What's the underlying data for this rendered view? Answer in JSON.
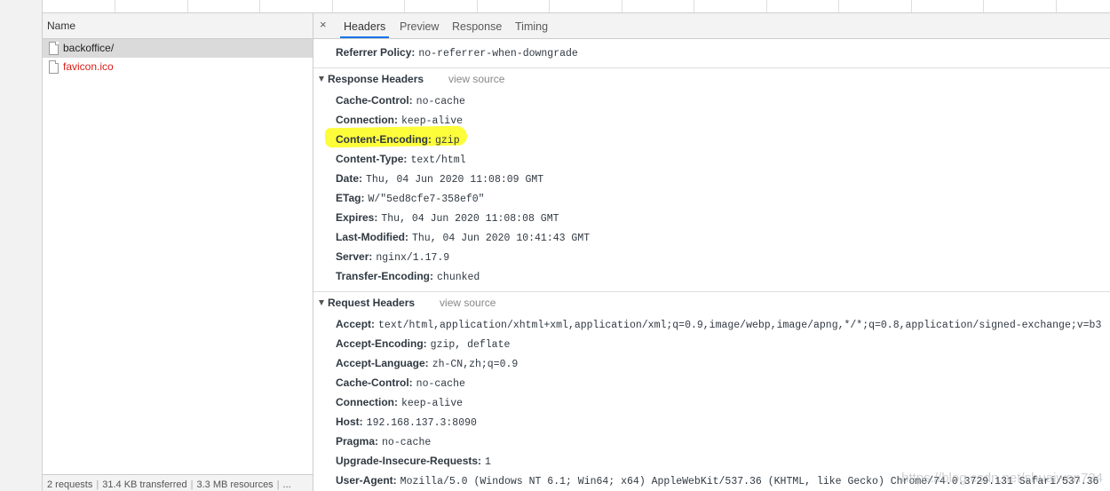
{
  "request_list": {
    "column_header": "Name",
    "rows": [
      {
        "name": "backoffice/",
        "selected": true,
        "error": false
      },
      {
        "name": "favicon.ico",
        "selected": false,
        "error": true
      }
    ],
    "status": {
      "requests": "2 requests",
      "transferred": "31.4 KB transferred",
      "resources": "3.3 MB resources",
      "more": "..."
    }
  },
  "details": {
    "close_symbol": "×",
    "tabs": [
      "Headers",
      "Preview",
      "Response",
      "Timing"
    ],
    "active_tab": "Headers",
    "general": [
      {
        "key": "Referrer Policy:",
        "value": "no-referrer-when-downgrade"
      }
    ],
    "response_headers": {
      "title": "Response Headers",
      "view_source": "view source",
      "items": [
        {
          "key": "Cache-Control:",
          "value": "no-cache"
        },
        {
          "key": "Connection:",
          "value": "keep-alive"
        },
        {
          "key": "Content-Encoding:",
          "value": "gzip"
        },
        {
          "key": "Content-Type:",
          "value": "text/html"
        },
        {
          "key": "Date:",
          "value": "Thu, 04 Jun 2020 11:08:09 GMT"
        },
        {
          "key": "ETag:",
          "value": "W/\"5ed8cfe7-358ef0\""
        },
        {
          "key": "Expires:",
          "value": "Thu, 04 Jun 2020 11:08:08 GMT"
        },
        {
          "key": "Last-Modified:",
          "value": "Thu, 04 Jun 2020 10:41:43 GMT"
        },
        {
          "key": "Server:",
          "value": "nginx/1.17.9"
        },
        {
          "key": "Transfer-Encoding:",
          "value": "chunked"
        }
      ]
    },
    "request_headers": {
      "title": "Request Headers",
      "view_source": "view source",
      "items": [
        {
          "key": "Accept:",
          "value": "text/html,application/xhtml+xml,application/xml;q=0.9,image/webp,image/apng,*/*;q=0.8,application/signed-exchange;v=b3"
        },
        {
          "key": "Accept-Encoding:",
          "value": "gzip, deflate"
        },
        {
          "key": "Accept-Language:",
          "value": "zh-CN,zh;q=0.9"
        },
        {
          "key": "Cache-Control:",
          "value": "no-cache"
        },
        {
          "key": "Connection:",
          "value": "keep-alive"
        },
        {
          "key": "Host:",
          "value": "192.168.137.3:8090"
        },
        {
          "key": "Pragma:",
          "value": "no-cache"
        },
        {
          "key": "Upgrade-Insecure-Requests:",
          "value": "1"
        },
        {
          "key": "User-Agent:",
          "value": "Mozilla/5.0 (Windows NT 6.1; Win64; x64) AppleWebKit/537.36 (KHTML, like Gecko) Chrome/74.0.3729.131 Safari/537.36"
        }
      ]
    }
  },
  "watermark": "https://blog.csdn.net/shuaiwen724",
  "colors": {
    "highlight": "#fdfd3a",
    "active_tab_underline": "#1a73e8",
    "error_text": "#d91e18"
  }
}
